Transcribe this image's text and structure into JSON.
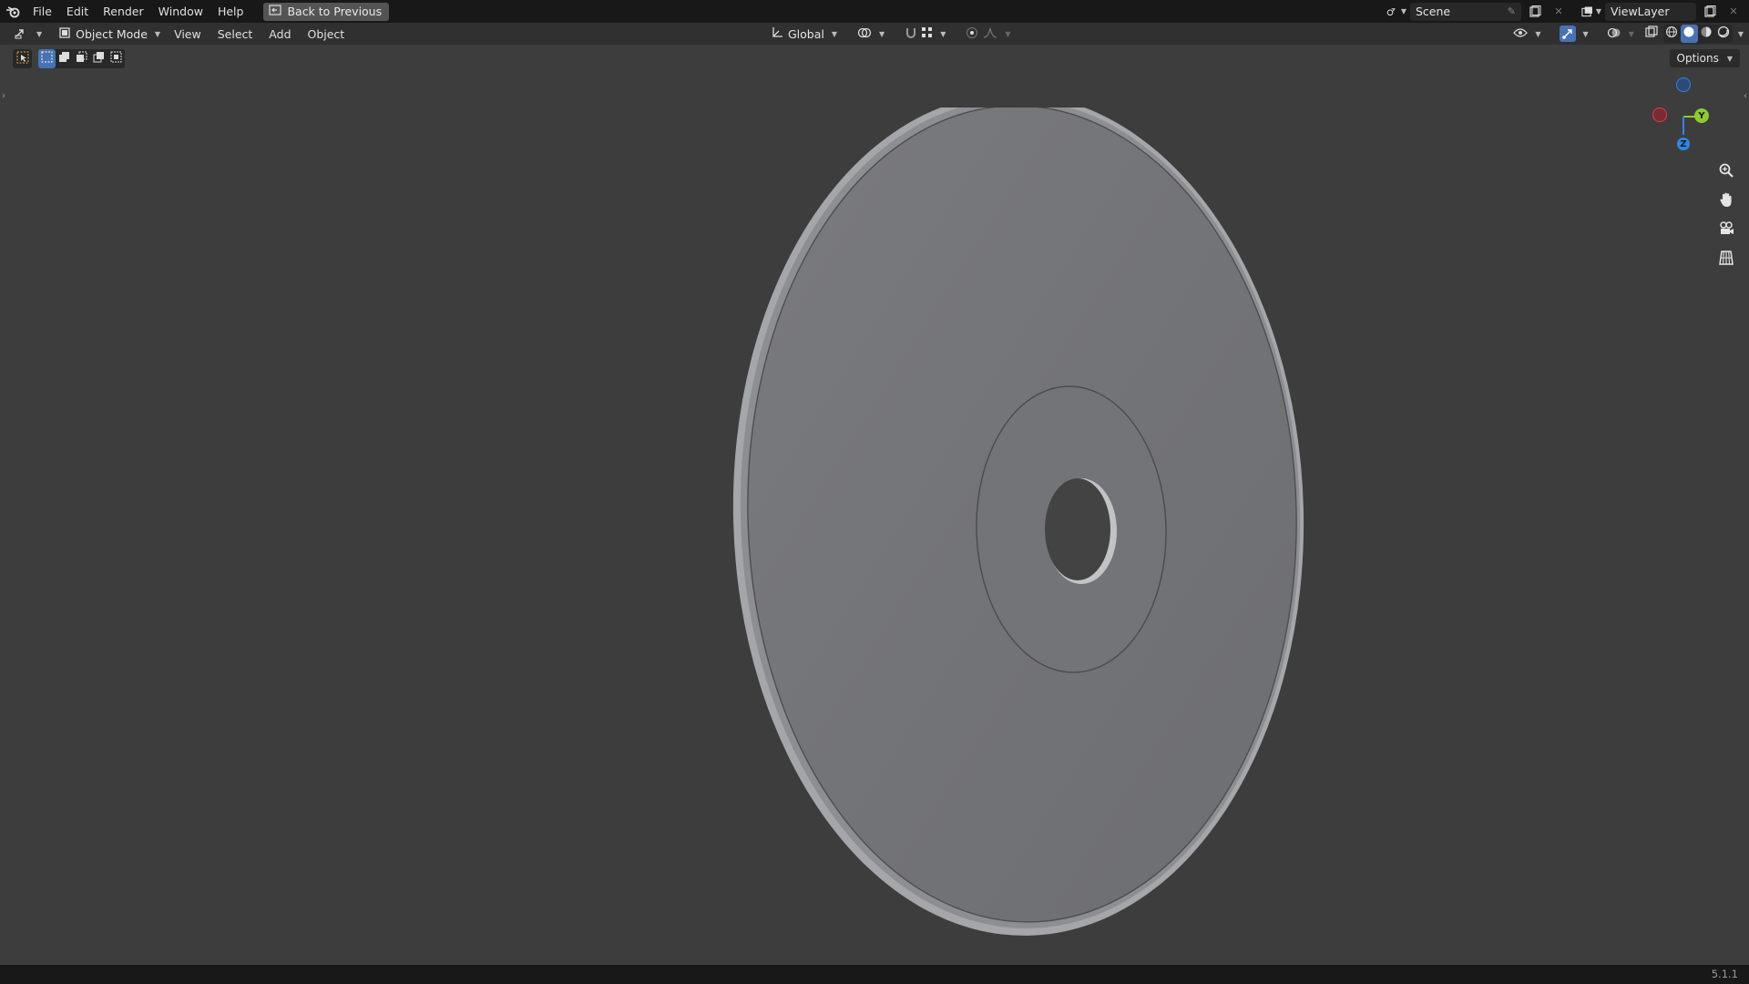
{
  "topbar": {
    "menus": [
      "File",
      "Edit",
      "Render",
      "Window",
      "Help"
    ],
    "back_button": "Back to Previous",
    "scene_name": "Scene",
    "view_layer_name": "ViewLayer"
  },
  "header": {
    "mode": "Object Mode",
    "menus": [
      "View",
      "Select",
      "Add",
      "Object"
    ],
    "transform_orientation": "Global"
  },
  "toolbar": {
    "options_label": "Options"
  },
  "gizmo": {
    "y_label": "Y",
    "z_label": "Z"
  },
  "status": {
    "version": "5.1.1"
  },
  "colors": {
    "accent": "#4772b3",
    "axis_x": "#e2394d",
    "axis_y": "#8ccd2d",
    "axis_z": "#2f86e5",
    "viewport_bg": "#3d3d3d"
  },
  "icons": [
    "blender-logo-icon",
    "back-icon",
    "editor-type-icon",
    "object-mode-icon",
    "transform-orientation-icon",
    "pivot-icon",
    "snap-icon",
    "proportional-icon",
    "visibility-icon",
    "gizmo-icon",
    "overlay-icon",
    "xray-icon",
    "wireframe-icon",
    "solid-icon",
    "material-icon",
    "rendered-icon",
    "zoom-icon",
    "pan-hand-icon",
    "camera-icon",
    "ortho-grid-icon"
  ]
}
